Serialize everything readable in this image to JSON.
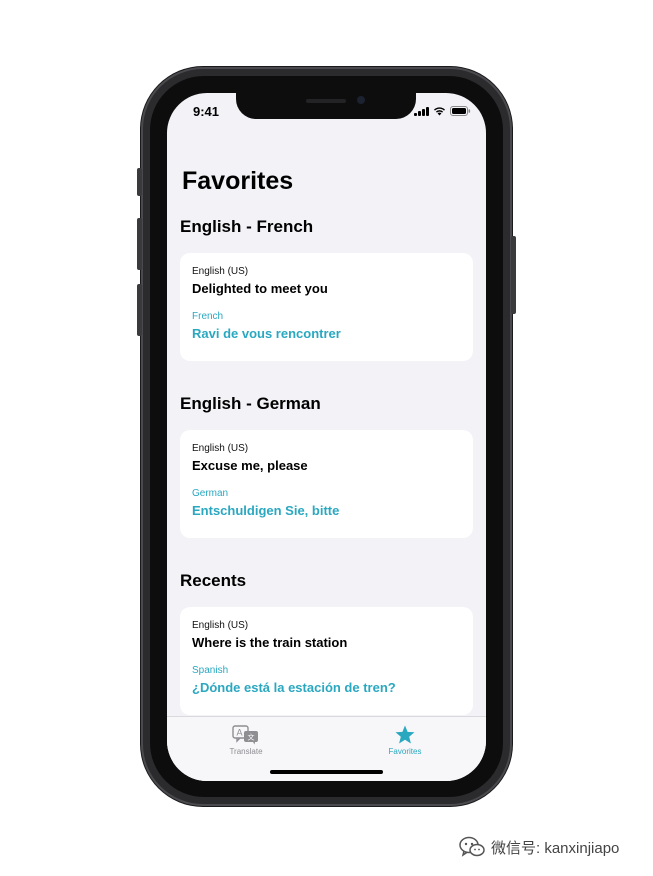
{
  "status_bar": {
    "time": "9:41"
  },
  "page": {
    "title": "Favorites"
  },
  "sections": [
    {
      "header": "English - French",
      "card": {
        "source_language": "English (US)",
        "source_text": "Delighted to meet you",
        "target_language": "French",
        "target_text": "Ravi de vous rencontrer"
      }
    },
    {
      "header": "English - German",
      "card": {
        "source_language": "English (US)",
        "source_text": "Excuse me, please",
        "target_language": "German",
        "target_text": "Entschuldigen Sie, bitte"
      }
    },
    {
      "header": "Recents",
      "card": {
        "source_language": "English (US)",
        "source_text": "Where is the train station",
        "target_language": "Spanish",
        "target_text": "¿Dónde está la estación de tren?"
      }
    }
  ],
  "tab_bar": {
    "tabs": [
      {
        "label": "Translate",
        "icon": "translate-icon",
        "selected": false
      },
      {
        "label": "Favorites",
        "icon": "star-icon",
        "selected": true
      }
    ]
  },
  "watermark": {
    "text": "微信号: kanxinjiapo"
  },
  "colors": {
    "accent": "#2aa8c0",
    "background": "#f2f2f7",
    "card": "#ffffff",
    "inactive_tab": "#8e8e93"
  }
}
